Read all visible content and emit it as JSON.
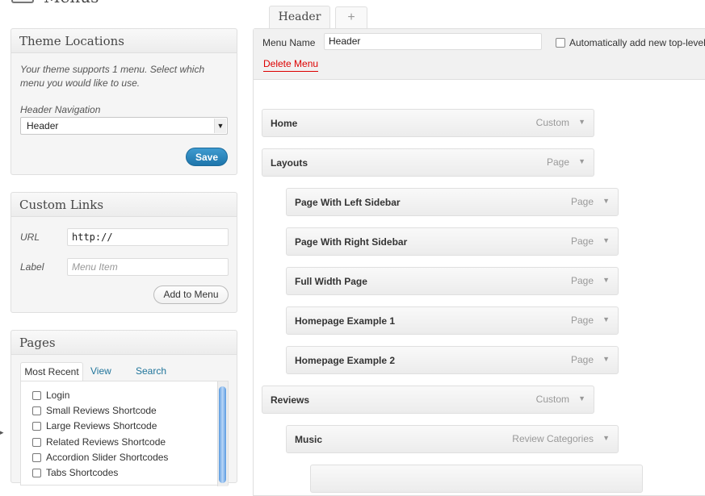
{
  "page": {
    "title": "Menus"
  },
  "theme_locations": {
    "heading": "Theme Locations",
    "description": "Your theme supports 1 menu. Select which menu you would like to use.",
    "location_label": "Header Navigation",
    "selected_menu": "Header",
    "save_label": "Save"
  },
  "custom_links": {
    "heading": "Custom Links",
    "url_label": "URL",
    "url_value": "http://",
    "label_label": "Label",
    "label_placeholder": "Menu Item",
    "add_label": "Add to Menu"
  },
  "pages": {
    "heading": "Pages",
    "tabs": [
      "Most Recent",
      "View All",
      "Search"
    ],
    "items": [
      "Login",
      "Small Reviews Shortcode",
      "Large Reviews Shortcode",
      "Related Reviews Shortcode",
      "Accordion Slider Shortcodes",
      "Tabs Shortcodes"
    ]
  },
  "menu_tabs": {
    "current": "Header",
    "add": "+"
  },
  "menu_editor": {
    "name_label": "Menu Name",
    "name_value": "Header",
    "auto_add_label": "Automatically add new top-level",
    "delete_label": "Delete Menu",
    "items": [
      {
        "title": "Home",
        "type": "Custom"
      },
      {
        "title": "Layouts",
        "type": "Page"
      },
      {
        "title": "Page With Left Sidebar",
        "type": "Page"
      },
      {
        "title": "Page With Right Sidebar",
        "type": "Page"
      },
      {
        "title": "Full Width Page",
        "type": "Page"
      },
      {
        "title": "Homepage Example 1",
        "type": "Page"
      },
      {
        "title": "Homepage Example 2",
        "type": "Page"
      },
      {
        "title": "Reviews",
        "type": "Custom"
      },
      {
        "title": "Music",
        "type": "Review Categories"
      },
      {
        "title": "",
        "type": ""
      }
    ]
  },
  "colors": {
    "primary_button": "#2a86c2",
    "link": "#21759b",
    "delete": "#dd0000"
  }
}
